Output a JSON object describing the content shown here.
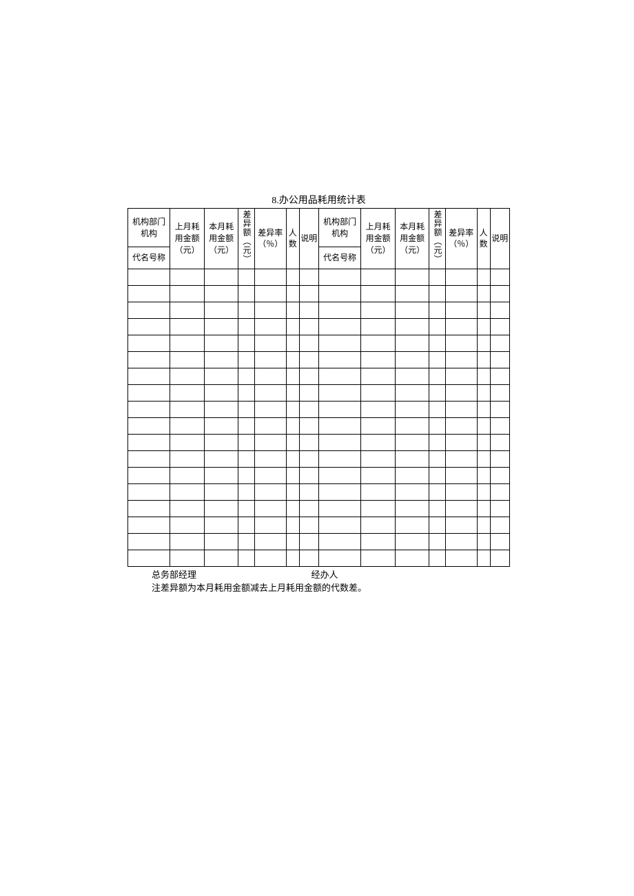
{
  "title": "8.办公用品耗用统计表",
  "headers": {
    "org_dept_top": "机构部门机构",
    "org_dept_sub": "代名号称",
    "last_month_top": "上月耗用金额（元）",
    "this_month_top": "本月耗用金额（元）",
    "diff_amount": "差异额（元）",
    "diff_rate": "差异率（％）",
    "people_count": "人数",
    "note": "说明"
  },
  "footer": {
    "manager_label": "总务部经理",
    "handler_label": "经办人",
    "note_text": "注差异额为本月耗用金额减去上月耗用金额的代数差。"
  },
  "data_row_count": 18
}
